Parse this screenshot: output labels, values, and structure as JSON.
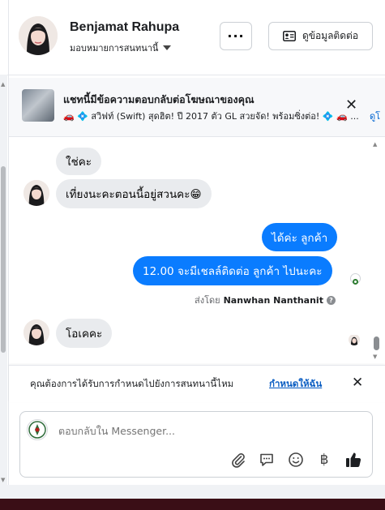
{
  "header": {
    "name": "Benjamat Rahupa",
    "assign_label": "มอบหมายการสนทนานี้",
    "more_label": "···",
    "contact_label": "ดูข้อมูลติดต่อ"
  },
  "ad_banner": {
    "title": "แชทนี้มีข้อความตอบกลับต่อโฆษณาของคุณ",
    "subtitle": "🚗 💠 สวิฟท์ (Swift) สุดฮิต! ปี 2017 ตัว GL สวยจัด! พร้อมซิ่งต่อ! 💠 🚗 ...",
    "more_label": "ดูโ"
  },
  "messages": [
    {
      "direction": "in",
      "text": "ใช่คะ"
    },
    {
      "direction": "in",
      "text": "เที่ยงนะคะตอนนี้อยู่สวนคะ😁"
    },
    {
      "direction": "out",
      "text": "ได้ค่ะ  ลูกค้า"
    },
    {
      "direction": "out",
      "text": "12.00 จะมีเชลล์ติดต่อ ลูกค้า ไปนะคะ"
    },
    {
      "direction": "in",
      "text": "โอเคคะ"
    }
  ],
  "sent_by": {
    "prefix": "ส่งโดย",
    "agent": "Nanwhan Nanthanit",
    "info": "?"
  },
  "routing": {
    "question": "คุณต้องการได้รับการกำหนดไปยังการสนทนานี้ไหม",
    "link": "กำหนดให้ฉัน",
    "close": "✕"
  },
  "composer": {
    "placeholder": "ตอบกลับใน Messenger...",
    "tools": [
      "paperclip-icon",
      "saved-reply-icon",
      "emoji-icon",
      "baht-icon",
      "like-icon"
    ]
  },
  "colors": {
    "outgoing": "#0a7cff",
    "incoming": "#e9ebee",
    "link": "#0a5dc2"
  }
}
